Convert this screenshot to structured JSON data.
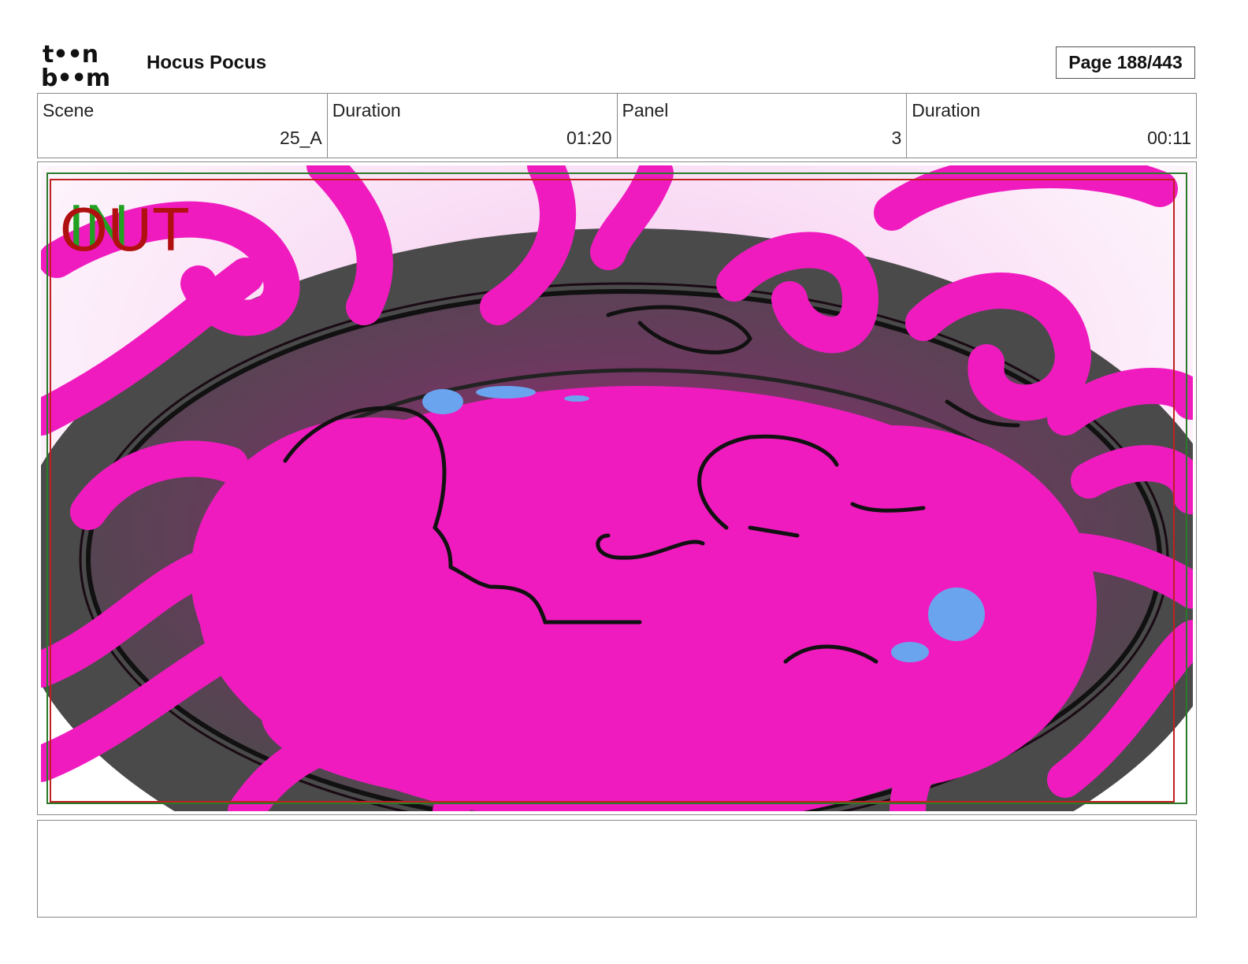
{
  "header": {
    "logo_line1": "t••n",
    "logo_line2": "b••m",
    "project_title": "Hocus Pocus",
    "page_label": "Page 188/443"
  },
  "info": {
    "scene_label": "Scene",
    "scene_value": "25_A",
    "scene_duration_label": "Duration",
    "scene_duration_value": "01:20",
    "panel_label": "Panel",
    "panel_value": "3",
    "panel_duration_label": "Duration",
    "panel_duration_value": "00:11"
  },
  "panel": {
    "in_marker": "IN",
    "out_marker": "OUT",
    "colors": {
      "magenta": "#f01bbf",
      "cauldron_dark": "#4a4a4a",
      "liquid_blue": "#6aa4ef",
      "in_green": "#22a022",
      "out_red": "#b01010",
      "safe_green": "#2a7a2a",
      "safe_red": "#c02020"
    }
  },
  "notes": {}
}
